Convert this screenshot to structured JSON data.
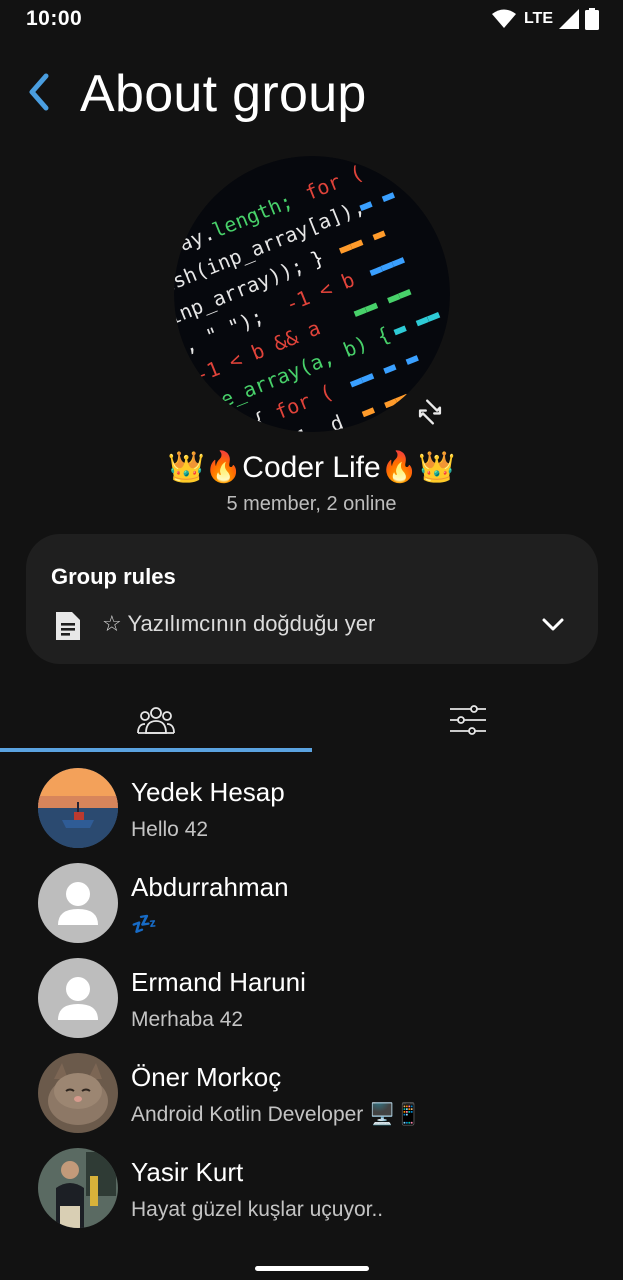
{
  "status_bar": {
    "time": "10:00",
    "network": "LTE"
  },
  "header": {
    "title": "About group"
  },
  "group": {
    "name": "Coder Life",
    "emoji_left": "👑🔥",
    "emoji_right": "🔥👑",
    "members_info": "5 member, 2 online"
  },
  "rules": {
    "title": "Group rules",
    "text": "☆ Yazılımcının doğduğu  yer"
  },
  "tabs": [
    {
      "name": "members",
      "icon": "people-group-icon",
      "selected": true
    },
    {
      "name": "settings",
      "icon": "sliders-icon",
      "selected": false
    }
  ],
  "members": [
    {
      "name": "Yedek Hesap",
      "status": "Hello 42",
      "avatar": "boat-photo"
    },
    {
      "name": "Abdurrahman",
      "status": "💤",
      "avatar": "default-person"
    },
    {
      "name": "Ermand Haruni",
      "status": "Merhaba 42",
      "avatar": "default-person"
    },
    {
      "name": "Öner Morkoç",
      "status": "Android Kotlin Developer 🖥️📱",
      "avatar": "cat-photo"
    },
    {
      "name": "Yasir Kurt",
      "status": "Hayat güzel kuşlar uçuyor..",
      "avatar": "person-photo"
    }
  ],
  "colors": {
    "background": "#121212",
    "card": "#1f1f1f",
    "accent": "#5ba3e0"
  }
}
